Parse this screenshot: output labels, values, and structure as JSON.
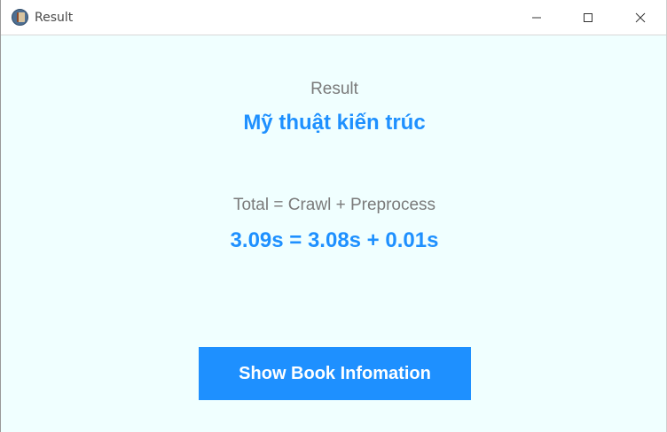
{
  "window": {
    "title": "Result",
    "icon": "book-icon",
    "controls": {
      "minimize": "minimize-icon",
      "maximize": "maximize-icon",
      "close": "close-icon"
    }
  },
  "main": {
    "result_label": "Result",
    "book_title": "Mỹ thuật kiến trúc",
    "formula_label": "Total = Crawl + Preprocess",
    "formula_value": "3.09s = 3.08s + 0.01s",
    "show_button_label": "Show Book Infomation"
  },
  "colors": {
    "background": "#f0ffff",
    "accent": "#1e90ff",
    "label_gray": "#7a7a7a",
    "button_text": "#ffffff"
  }
}
